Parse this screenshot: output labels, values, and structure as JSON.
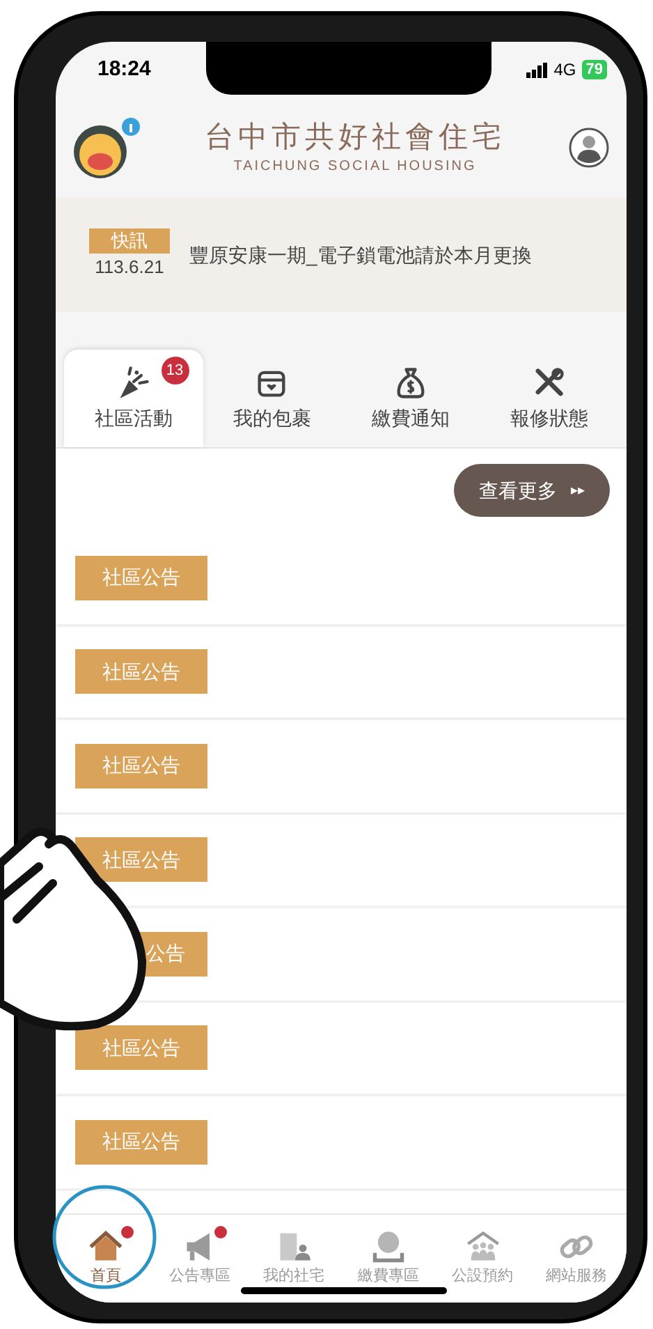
{
  "status_bar": {
    "time": "18:24",
    "network": "4G",
    "battery": "79"
  },
  "header": {
    "title": "台中市共好社會住宅",
    "subtitle": "TAICHUNG SOCIAL HOUSING"
  },
  "news": {
    "tag": "快訊",
    "date": "113.6.21",
    "text": "豐原安康一期_電子鎖電池請於本月更換"
  },
  "tabs": [
    {
      "label": "社區活動",
      "selected": true,
      "badge": "13"
    },
    {
      "label": "我的包裹",
      "selected": false
    },
    {
      "label": "繳費通知",
      "selected": false
    },
    {
      "label": "報修狀態",
      "selected": false
    }
  ],
  "more_button": {
    "label": "查看更多",
    "arrow": "▸▸"
  },
  "announcements": [
    {
      "tag": "社區公告"
    },
    {
      "tag": "社區公告"
    },
    {
      "tag": "社區公告"
    },
    {
      "tag": "社區公告"
    },
    {
      "tag": "公告",
      "kind": "covered"
    },
    {
      "tag": "社區公告"
    },
    {
      "tag": "社區公告"
    }
  ],
  "bottom_nav": [
    {
      "label": "首頁",
      "selected": true,
      "dot": true
    },
    {
      "label": "公告專區",
      "selected": false,
      "dot": true
    },
    {
      "label": "我的社宅",
      "selected": false,
      "dot": false
    },
    {
      "label": "繳費專區",
      "selected": false,
      "dot": false
    },
    {
      "label": "公設預約",
      "selected": false,
      "dot": false
    },
    {
      "label": "網站服務",
      "selected": false,
      "dot": false
    }
  ]
}
